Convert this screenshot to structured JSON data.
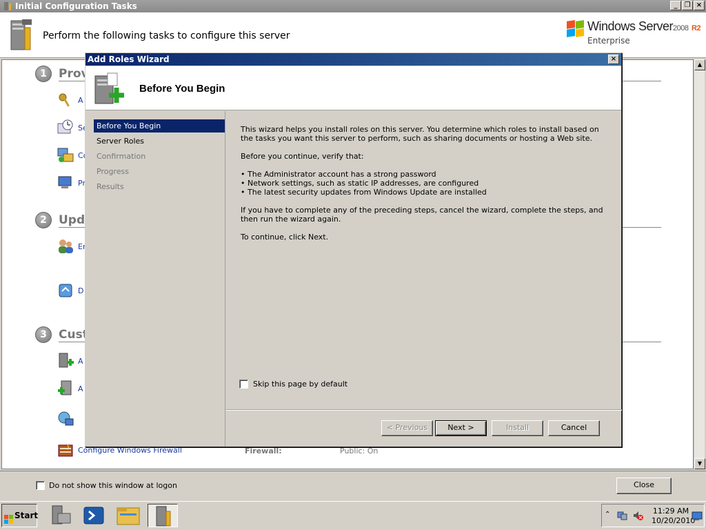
{
  "back_window": {
    "title": "Initial Configuration Tasks",
    "header_text": "Perform the following tasks to configure this server",
    "brand": {
      "name": "Windows Server",
      "version": "2008",
      "edition_suffix": "R2",
      "edition": "Enterprise"
    },
    "sections": [
      {
        "number": "1",
        "title": "Provi"
      },
      {
        "number": "2",
        "title": "Upda"
      },
      {
        "number": "3",
        "title": "Custo"
      }
    ],
    "tasks": [
      {
        "label": "A"
      },
      {
        "label": "Se"
      },
      {
        "label": "Co"
      },
      {
        "label": "Pr"
      },
      {
        "label": "En"
      },
      {
        "label": "D"
      },
      {
        "label": "A"
      },
      {
        "label": "A"
      },
      {
        "label": ""
      },
      {
        "label": "Configure Windows Firewall"
      }
    ],
    "firewall_label": "Firewall:",
    "firewall_value": "Public: On",
    "dont_show_label": "Do not show this window at logon",
    "close_label": "Close"
  },
  "dialog": {
    "title": "Add Roles Wizard",
    "heading": "Before You Begin",
    "nav": [
      "Before You Begin",
      "Server Roles",
      "Confirmation",
      "Progress",
      "Results"
    ],
    "intro": "This wizard helps you install roles on this server. You determine which roles to install based on the tasks you want this server to perform, such as sharing documents or hosting a Web site.",
    "verify": "Before you continue, verify that:",
    "bullets": [
      "The Administrator account has a strong password",
      "Network settings, such as static IP addresses, are configured",
      "The latest security updates from Windows Update are installed"
    ],
    "preceding": "If you have to complete any of the preceding steps, cancel the wizard, complete the steps, and then run the wizard again.",
    "continue": "To continue, click Next.",
    "skip_label": "Skip this page by default",
    "buttons": {
      "previous": "< Previous",
      "next": "Next >",
      "install": "Install",
      "cancel": "Cancel"
    }
  },
  "taskbar": {
    "start_label": "Start",
    "time": "11:29 AM",
    "date": "10/20/2010"
  }
}
